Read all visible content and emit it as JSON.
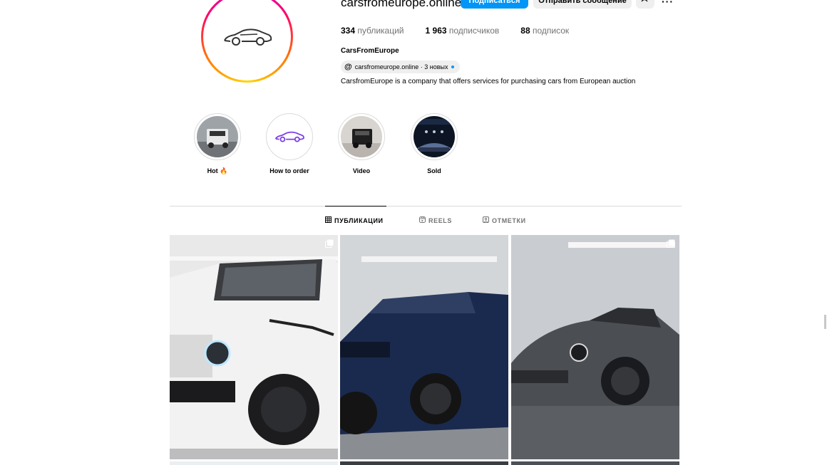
{
  "profile": {
    "username": "carsfromeurope.online",
    "follow_label": "Подписаться",
    "message_label": "Отправить сообщение",
    "more_label": "···",
    "stats": [
      {
        "value": "334",
        "label": "публикаций"
      },
      {
        "value": "1 963",
        "label": "подписчиков"
      },
      {
        "value": "88",
        "label": "подписок"
      }
    ],
    "full_name": "CarsFromEurope",
    "threads_link": "carsfromeurope.online · 3 новых",
    "bio": "CarsfromEurope is a company that offers services for purchasing cars from European auction"
  },
  "highlights": [
    {
      "label": "Hot 🔥"
    },
    {
      "label": "How to order"
    },
    {
      "label": "Video"
    },
    {
      "label": "Sold"
    }
  ],
  "tabs": [
    {
      "label": "ПУБЛИКАЦИИ",
      "icon": "grid-icon",
      "active": true
    },
    {
      "label": "REELS",
      "icon": "reels-icon",
      "active": false
    },
    {
      "label": "ОТМЕТКИ",
      "icon": "tagged-icon",
      "active": false
    }
  ],
  "colors": {
    "accent": "#0095f6",
    "button_gray": "#efefef",
    "divider": "#dbdbdb",
    "muted_text": "#737373"
  }
}
